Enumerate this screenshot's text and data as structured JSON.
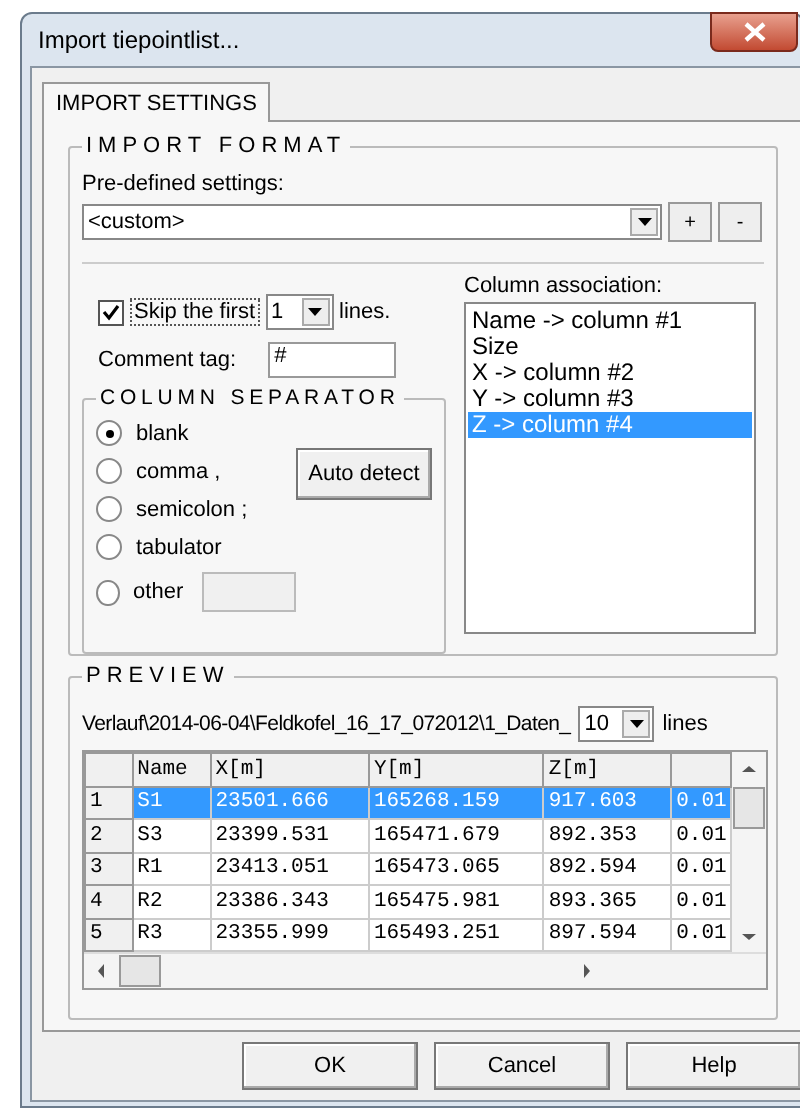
{
  "window": {
    "title": "Import tiepointlist..."
  },
  "tabs": [
    {
      "label": "IMPORT SETTINGS",
      "selected": true
    }
  ],
  "import_format": {
    "title": "IMPORT FORMAT",
    "predefined_label": "Pre-defined settings:",
    "predefined_value": "<custom>",
    "add_button": "+",
    "remove_button": "-",
    "skip_first": {
      "checked": true,
      "label": "Skip the first",
      "value": "1",
      "suffix": "lines."
    },
    "comment_tag": {
      "label": "Comment tag:",
      "value": "#"
    },
    "column_separator": {
      "title": "COLUMN SEPARATOR",
      "options": [
        {
          "label": "blank",
          "selected": true
        },
        {
          "label": "comma ,",
          "selected": false
        },
        {
          "label": "semicolon ;",
          "selected": false
        },
        {
          "label": "tabulator",
          "selected": false
        },
        {
          "label": "other",
          "selected": false,
          "kind": "with_field"
        }
      ]
    },
    "auto_detect": "Auto detect",
    "column_association": {
      "label": "Column association:",
      "items": [
        {
          "text": "Name -> column #1",
          "selected": false
        },
        {
          "text": "Size",
          "selected": false
        },
        {
          "text": "X -> column #2",
          "selected": false
        },
        {
          "text": "Y -> column #3",
          "selected": false
        },
        {
          "text": "Z -> column #4",
          "selected": true
        }
      ]
    }
  },
  "preview": {
    "title": "PREVIEW",
    "path": "Verlauf\\2014-06-04\\Feldkofel_16_17_072012\\1_Daten_",
    "lines_value": "10",
    "lines_label": "lines",
    "table": {
      "columns": [
        "Name",
        "X[m]",
        "Y[m]",
        "Z[m]"
      ],
      "rows": [
        {
          "index": "1",
          "cells": [
            "S1",
            "23501.666",
            "165268.159",
            "917.603",
            "0.01"
          ],
          "selected": true
        },
        {
          "index": "2",
          "cells": [
            "S3",
            "23399.531",
            "165471.679",
            "892.353",
            "0.01"
          ],
          "selected": false
        },
        {
          "index": "3",
          "cells": [
            "R1",
            "23413.051",
            "165473.065",
            "892.594",
            "0.01"
          ],
          "selected": false
        },
        {
          "index": "4",
          "cells": [
            "R2",
            "23386.343",
            "165475.981",
            "893.365",
            "0.01"
          ],
          "selected": false
        },
        {
          "index": "5",
          "cells": [
            "R3",
            "23355.999",
            "165493.251",
            "897.594",
            "0.01"
          ],
          "selected": false
        }
      ]
    }
  },
  "buttons": [
    "OK",
    "Cancel",
    "Help"
  ]
}
